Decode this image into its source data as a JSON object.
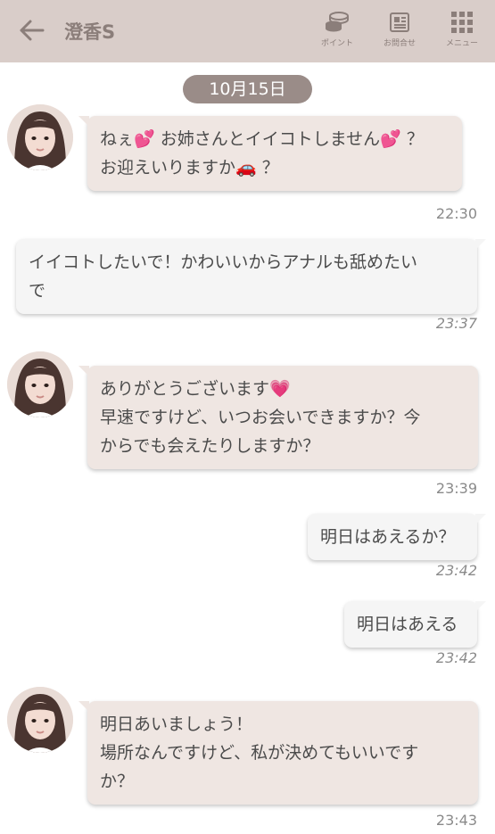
{
  "header": {
    "title": "澄香S",
    "points_label": "ポイント",
    "inquiry_label": "お問合せ",
    "menu_label": "メニュー"
  },
  "date": "10月15日",
  "messages": [
    {
      "side": "in",
      "lines": [
        "ねぇ💕 お姉さんとイイコトしません💕 ？",
        "お迎えいりますか🚗 ？"
      ],
      "time": "22:30"
    },
    {
      "side": "out",
      "lines": [
        "イイコトしたいで！かわいいからアナルも舐めたい",
        "で"
      ],
      "time": "23:37"
    },
    {
      "side": "in",
      "lines": [
        "ありがとうございます💗",
        "早速ですけど、いつお会いできますか？今",
        "からでも会えたりしますか？"
      ],
      "time": "23:39"
    },
    {
      "side": "out",
      "lines": [
        "明日はあえるか？"
      ],
      "time": "23:42"
    },
    {
      "side": "out",
      "lines": [
        "明日はあえる"
      ],
      "time": "23:42"
    },
    {
      "side": "in",
      "lines": [
        "明日あいましょう！",
        "場所なんですけど、私が決めてもいいです",
        "か？"
      ],
      "time": "23:43"
    }
  ],
  "colors": {
    "header_bg": "#d9cdc9",
    "incoming_bubble": "#efe6e2",
    "outgoing_bubble": "#f5f5f5",
    "date_pill": "#9a8c88"
  }
}
